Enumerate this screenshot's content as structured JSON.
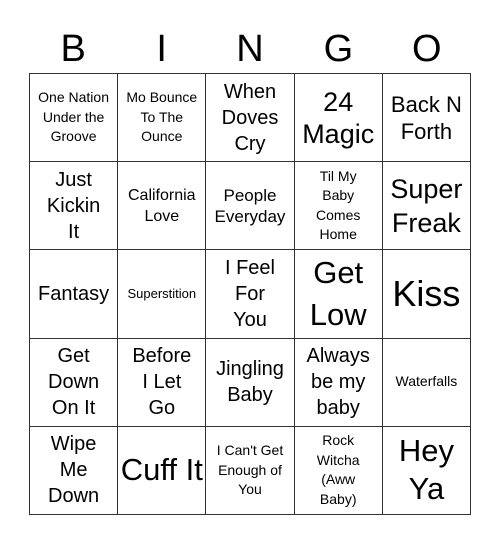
{
  "header": [
    "B",
    "I",
    "N",
    "G",
    "O"
  ],
  "cells": [
    [
      "One Nation Under the Groove",
      "Mo Bounce To The Ounce",
      "When Doves Cry",
      "24 Magic",
      "Back N Forth"
    ],
    [
      "Just Kickin It",
      "California Love",
      "People Everyday",
      "Til My Baby Comes Home",
      "Super Freak"
    ],
    [
      "Fantasy",
      "Superstition",
      "I Feel For You",
      "Get Low",
      "Kiss"
    ],
    [
      "Get Down On It",
      "Before I Let Go",
      "Jingling Baby",
      "Always be my baby",
      "Waterfalls"
    ],
    [
      "Wipe Me Down",
      "Cuff It",
      "I Can't Get Enough of You",
      "Rock Witcha (Aww Baby)",
      "Hey Ya"
    ]
  ]
}
